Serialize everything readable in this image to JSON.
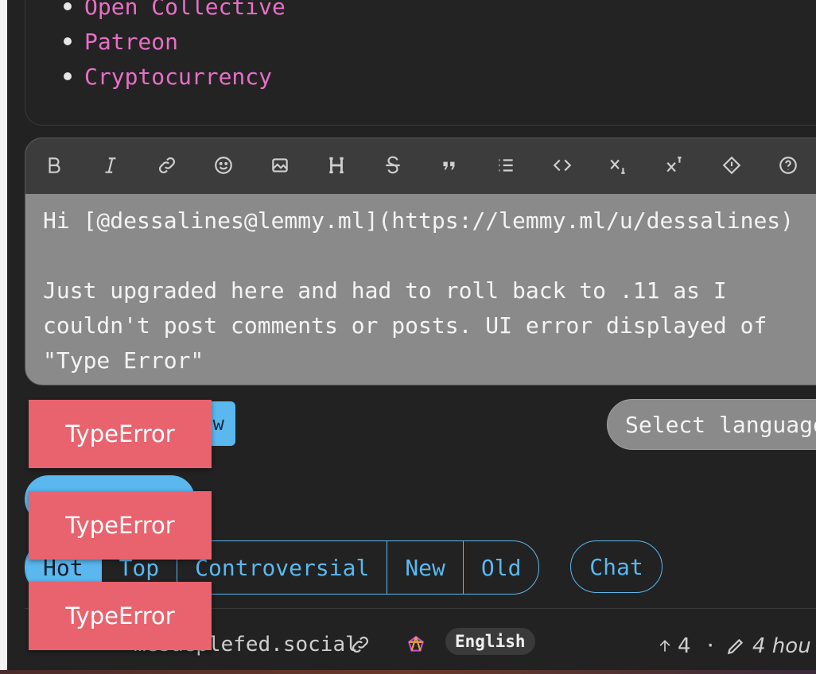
{
  "donate": {
    "items": [
      "Open Collective",
      "Patreon",
      "Cryptocurrency"
    ]
  },
  "editor": {
    "toolbar_icons": [
      "bold-icon",
      "italic-icon",
      "link-icon",
      "emoji-icon",
      "image-icon",
      "header-icon",
      "strikethrough-icon",
      "quote-icon",
      "list-icon",
      "code-icon",
      "subscript-icon",
      "superscript-icon",
      "spoiler-icon",
      "help-icon"
    ],
    "text": "Hi [@dessalines@lemmy.ml](https://lemmy.ml/u/dessalines)\n\nJust upgraded here and had to roll back to .11 as I\ncouldn't post comments or posts. UI error displayed of\n\"Type Error\""
  },
  "actions": {
    "preview_label": "w",
    "language_select": "Select language"
  },
  "sort": {
    "options": [
      "Hot",
      "Top",
      "Controversial",
      "New",
      "Old"
    ],
    "active": "Hot",
    "chat_label": "Chat"
  },
  "meta": {
    "domain": "mesaeplefed.social",
    "language": "English",
    "score": "4",
    "separator": "·",
    "time": "4 hou"
  },
  "toasts": [
    "TypeError",
    "TypeError",
    "TypeError"
  ],
  "colors": {
    "background": "#222222",
    "accent": "#5ab8ef",
    "link_pink": "#e86fc6",
    "toast": "#e8636e"
  }
}
